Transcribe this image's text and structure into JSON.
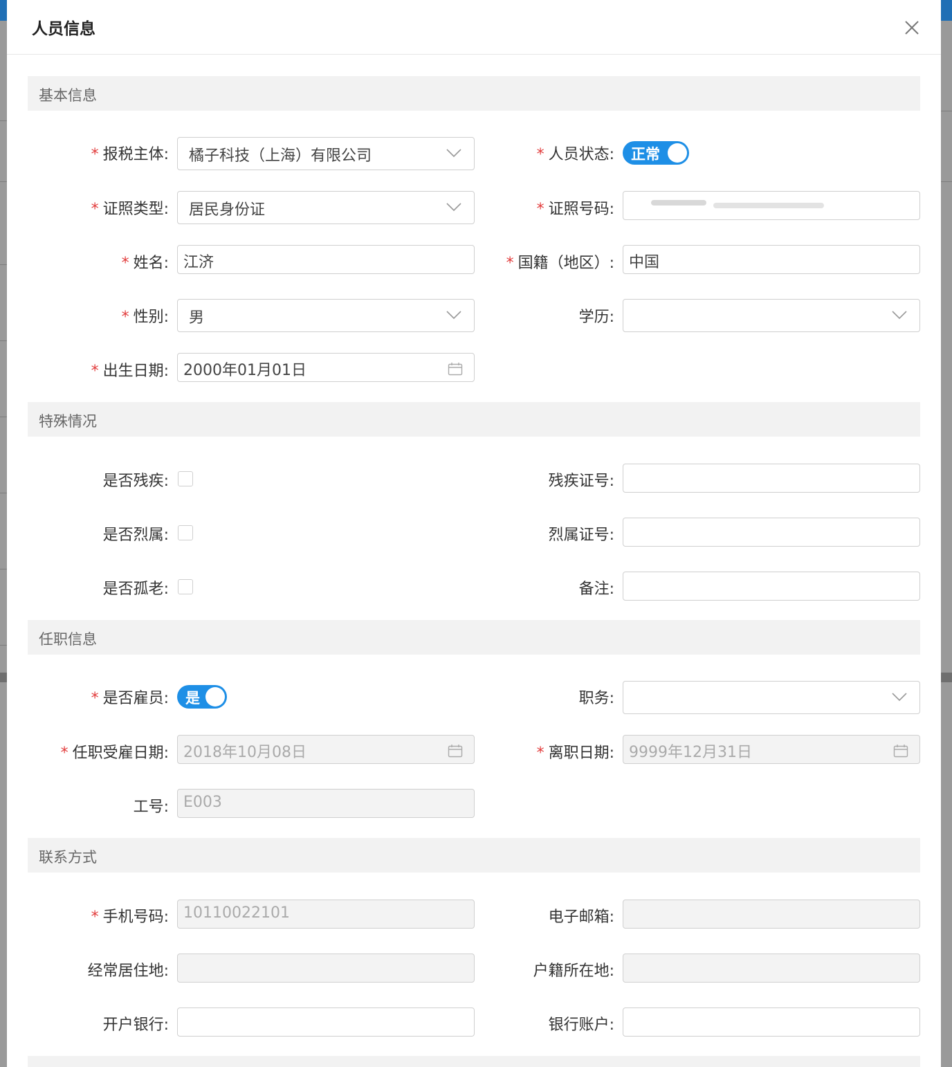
{
  "modal": {
    "title": "人员信息"
  },
  "sections": {
    "basic": "基本信息",
    "special": "特殊情况",
    "employment": "任职信息",
    "contact": "联系方式"
  },
  "basic": {
    "taxpayer_label": "报税主体:",
    "taxpayer_value": "橘子科技（上海）有限公司",
    "status_label": "人员状态:",
    "status_value": "正常",
    "id_type_label": "证照类型:",
    "id_type_value": "居民身份证",
    "id_number_label": "证照号码:",
    "name_label": "姓名:",
    "name_value": "江济",
    "nationality_label": "国籍（地区）:",
    "nationality_value": "中国",
    "gender_label": "性别:",
    "gender_value": "男",
    "education_label": "学历:",
    "education_value": "",
    "birthdate_label": "出生日期:",
    "birthdate_value": "2000年01月01日"
  },
  "special": {
    "disabled_label": "是否残疾:",
    "disabled_checked": false,
    "disability_cert_label": "残疾证号:",
    "disability_cert_value": "",
    "martyr_label": "是否烈属:",
    "martyr_checked": false,
    "martyr_cert_label": "烈属证号:",
    "martyr_cert_value": "",
    "elderly_label": "是否孤老:",
    "elderly_checked": false,
    "remark_label": "备注:",
    "remark_value": ""
  },
  "employment": {
    "is_employee_label": "是否雇员:",
    "is_employee_value": "是",
    "position_label": "职务:",
    "position_value": "",
    "hire_date_label": "任职受雇日期:",
    "hire_date_value": "2018年10月08日",
    "leave_date_label": "离职日期:",
    "leave_date_value": "9999年12月31日",
    "emp_no_label": "工号:",
    "emp_no_value": "E003"
  },
  "contact": {
    "phone_label": "手机号码:",
    "phone_value": "10110022101",
    "email_label": "电子邮箱:",
    "email_value": "",
    "residence_label": "经常居住地:",
    "residence_value": "",
    "household_label": "户籍所在地:",
    "household_value": "",
    "bank_label": "开户银行:",
    "bank_value": "",
    "account_label": "银行账户:",
    "account_value": ""
  },
  "required_mark": "*",
  "colors": {
    "toggle_on": "#1e8fe6",
    "required": "#e23b3b",
    "section_bg": "#f2f2f2"
  }
}
